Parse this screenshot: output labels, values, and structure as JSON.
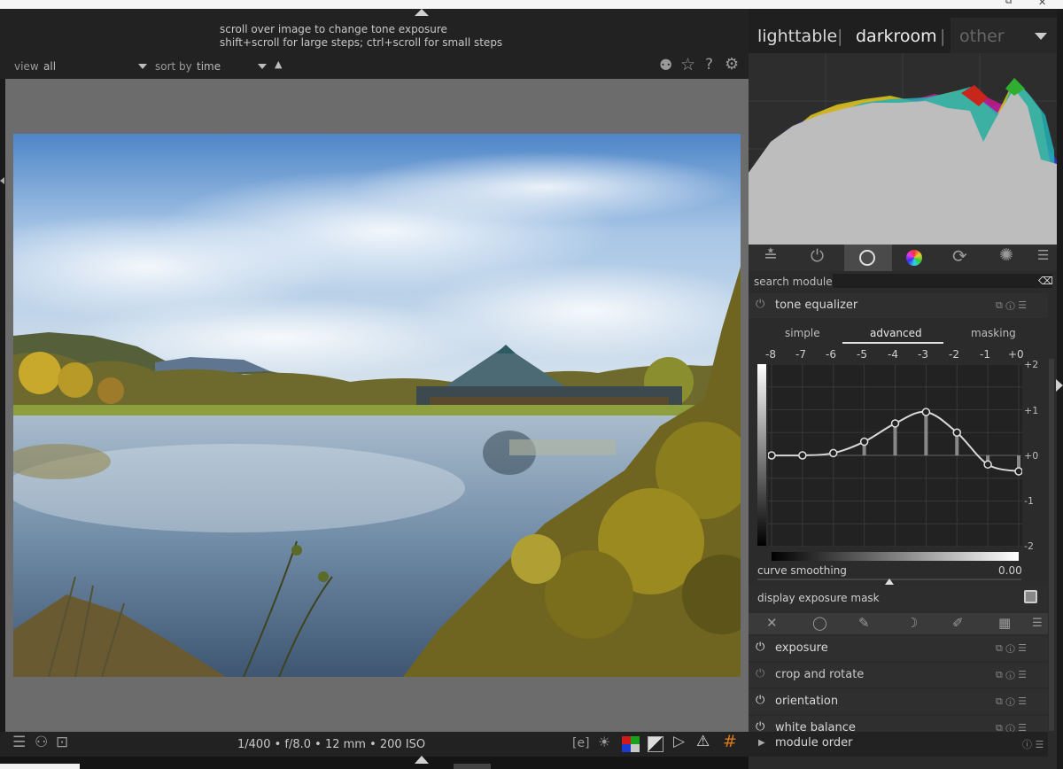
{
  "hints": {
    "line1": "scroll over image to change tone exposure",
    "line2": "shift+scroll for large steps; ctrl+scroll for small steps"
  },
  "filterbar": {
    "view_label": "view",
    "view_value": "all",
    "sort_label": "sort by",
    "sort_value": "time"
  },
  "views": {
    "lighttable": "lighttable",
    "sep": "|",
    "darkroom": "darkroom",
    "other": "other"
  },
  "search": {
    "label": "search module",
    "placeholder": ""
  },
  "tone_equalizer": {
    "title": "tone equalizer",
    "tabs": [
      "simple",
      "advanced",
      "masking"
    ],
    "active_tab": "advanced",
    "ev_labels": [
      "-8",
      "-7",
      "-6",
      "-5",
      "-4",
      "-3",
      "-2",
      "-1",
      "+0"
    ],
    "y_labels": [
      "+2",
      "+1",
      "+0",
      "-1",
      "-2"
    ],
    "curve_values": [
      0,
      0,
      0.05,
      0.3,
      0.7,
      0.95,
      0.5,
      -0.2,
      -0.35
    ],
    "curve_smoothing_label": "curve smoothing",
    "curve_smoothing_value": "0.00",
    "display_mask_label": "display exposure mask"
  },
  "modules": [
    {
      "name": "exposure",
      "enabled": true
    },
    {
      "name": "crop and rotate",
      "enabled": false
    },
    {
      "name": "orientation",
      "enabled": true
    },
    {
      "name": "white balance",
      "enabled": true
    }
  ],
  "module_order": {
    "label": "module order"
  },
  "bottombar": {
    "exif": "1/400 • f/8.0 • 12 mm • 200 ISO"
  },
  "colors": {
    "panel_bg": "#2b2b2b",
    "canvas_bg": "#6c6c6c",
    "text": "#cfcfcf"
  }
}
